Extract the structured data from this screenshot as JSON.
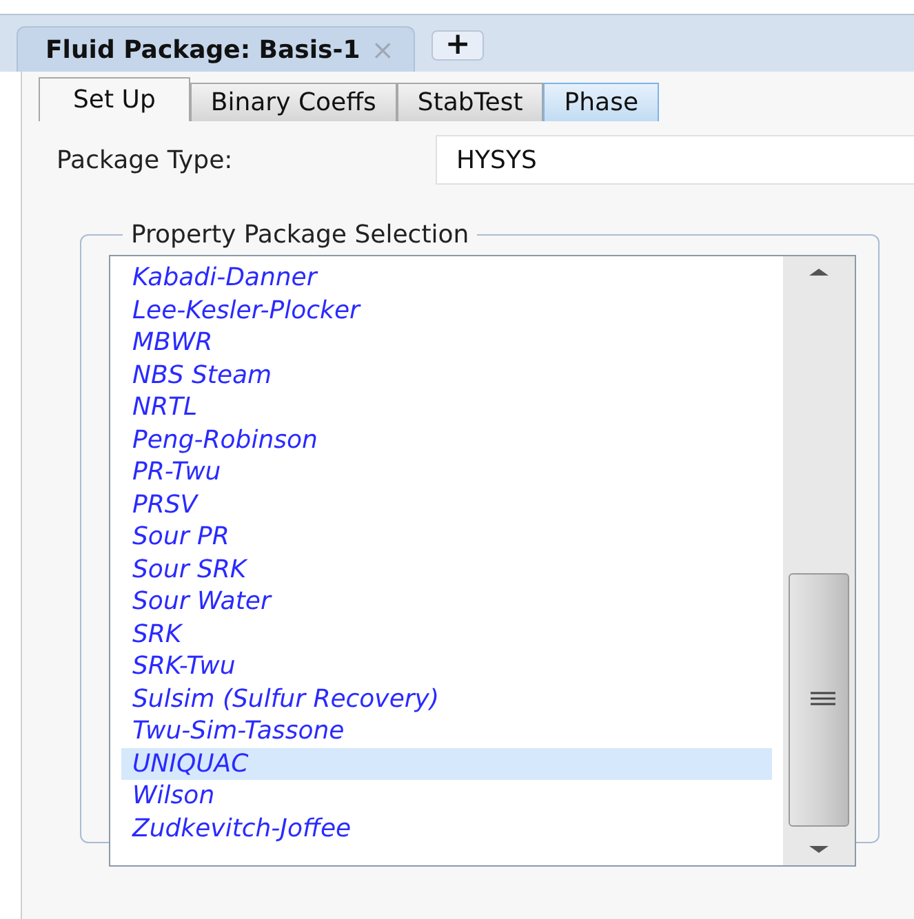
{
  "document_tab": {
    "title": "Fluid Package: Basis-1",
    "close": "×",
    "add": "+"
  },
  "tabs": [
    {
      "label": "Set Up",
      "selected": true
    },
    {
      "label": "Binary Coeffs",
      "selected": false
    },
    {
      "label": "StabTest",
      "selected": false
    },
    {
      "label": "Phase",
      "selected": false
    }
  ],
  "package_type": {
    "label": "Package Type:",
    "value": "HYSYS"
  },
  "property_package_selection": {
    "title": "Property Package Selection",
    "items": [
      {
        "label": "Kabadi-Danner",
        "selected": false
      },
      {
        "label": "Lee-Kesler-Plocker",
        "selected": false
      },
      {
        "label": "MBWR",
        "selected": false
      },
      {
        "label": "NBS Steam",
        "selected": false
      },
      {
        "label": "NRTL",
        "selected": false
      },
      {
        "label": "Peng-Robinson",
        "selected": false
      },
      {
        "label": "PR-Twu",
        "selected": false
      },
      {
        "label": "PRSV",
        "selected": false
      },
      {
        "label": "Sour PR",
        "selected": false
      },
      {
        "label": "Sour SRK",
        "selected": false
      },
      {
        "label": "Sour Water",
        "selected": false
      },
      {
        "label": "SRK",
        "selected": false
      },
      {
        "label": "SRK-Twu",
        "selected": false
      },
      {
        "label": "Sulsim (Sulfur Recovery)",
        "selected": false
      },
      {
        "label": "Twu-Sim-Tassone",
        "selected": false
      },
      {
        "label": "UNIQUAC",
        "selected": true
      },
      {
        "label": "Wilson",
        "selected": false
      },
      {
        "label": "Zudkevitch-Joffee",
        "selected": false
      }
    ]
  }
}
